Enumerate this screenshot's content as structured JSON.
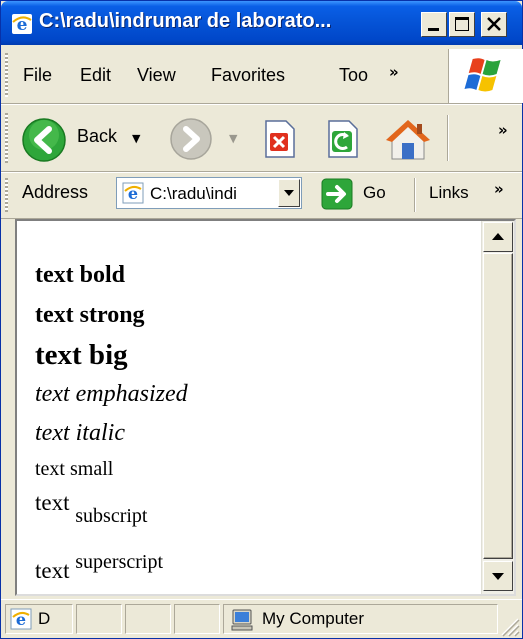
{
  "window": {
    "title": "C:\\radu\\indrumar de laborato...",
    "buttons": [
      "minimize",
      "maximize",
      "close"
    ]
  },
  "menu": {
    "items": [
      "File",
      "Edit",
      "View",
      "Favorites",
      "Too"
    ],
    "overflow": "»"
  },
  "toolbar": {
    "back_label": "Back",
    "overflow": "»"
  },
  "address": {
    "label": "Address",
    "value": "C:\\radu\\indi",
    "go_label": "Go",
    "links_label": "Links",
    "overflow": "»"
  },
  "content": {
    "bold": "text bold",
    "strong": "text strong",
    "big": "text big",
    "emphasized": "text emphasized",
    "italic": "text italic",
    "small": "text small",
    "sub_prefix": "text",
    "subscript": "subscript",
    "sup_prefix": "text",
    "superscript": "superscript"
  },
  "status": {
    "panel1": "D",
    "zone": "My Computer"
  },
  "colors": {
    "title_bar": "#0553d6",
    "chrome": "#ece9d8",
    "close_red": "#e0301e",
    "go_green": "#2ea63a"
  }
}
